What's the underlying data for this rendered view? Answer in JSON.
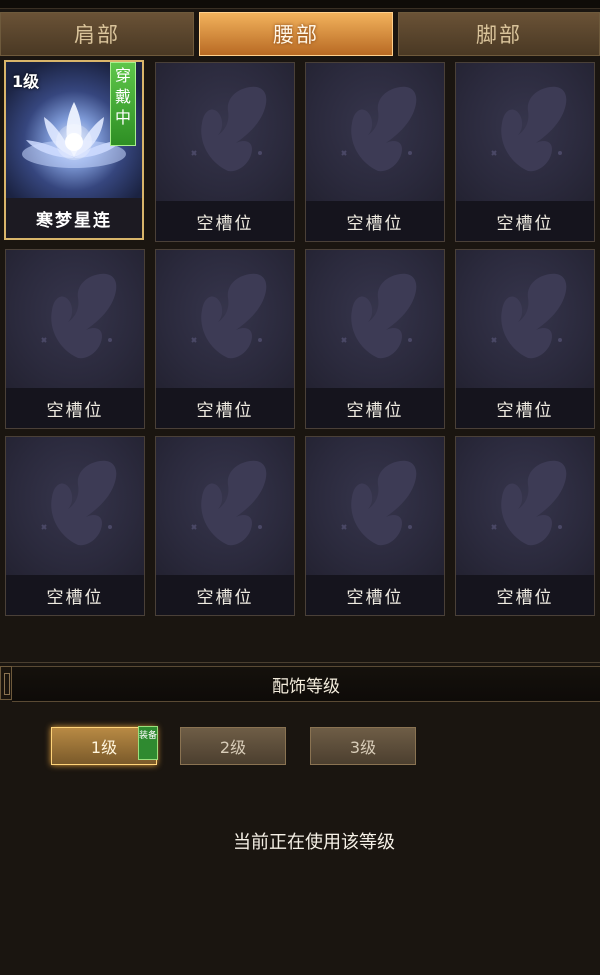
{
  "tabs": [
    {
      "label": "肩部",
      "active": false
    },
    {
      "label": "腰部",
      "active": true
    },
    {
      "label": "脚部",
      "active": false
    }
  ],
  "slots": [
    {
      "name": "寒梦星连",
      "level": "1级",
      "badge": "穿戴中",
      "equipped": true,
      "icon": "lotus-icon"
    },
    {
      "name": "空槽位",
      "icon": "butterfly-icon"
    },
    {
      "name": "空槽位",
      "icon": "butterfly-icon"
    },
    {
      "name": "空槽位",
      "icon": "butterfly-icon"
    },
    {
      "name": "空槽位",
      "icon": "butterfly-icon"
    },
    {
      "name": "空槽位",
      "icon": "butterfly-icon"
    },
    {
      "name": "空槽位",
      "icon": "butterfly-icon"
    },
    {
      "name": "空槽位",
      "icon": "butterfly-icon"
    },
    {
      "name": "空槽位",
      "icon": "butterfly-icon"
    },
    {
      "name": "空槽位",
      "icon": "butterfly-icon"
    },
    {
      "name": "空槽位",
      "icon": "butterfly-icon"
    },
    {
      "name": "空槽位",
      "icon": "butterfly-icon"
    }
  ],
  "section": {
    "title": "配饰等级"
  },
  "levels": [
    {
      "label": "1级",
      "selected": true,
      "badge": "装备"
    },
    {
      "label": "2级",
      "selected": false
    },
    {
      "label": "3级",
      "selected": false
    }
  ],
  "status": "当前正在使用该等级",
  "colors": {
    "accent": "#e8a640",
    "badge_green": "#2f8a30",
    "slot_bg": "#27242f"
  }
}
